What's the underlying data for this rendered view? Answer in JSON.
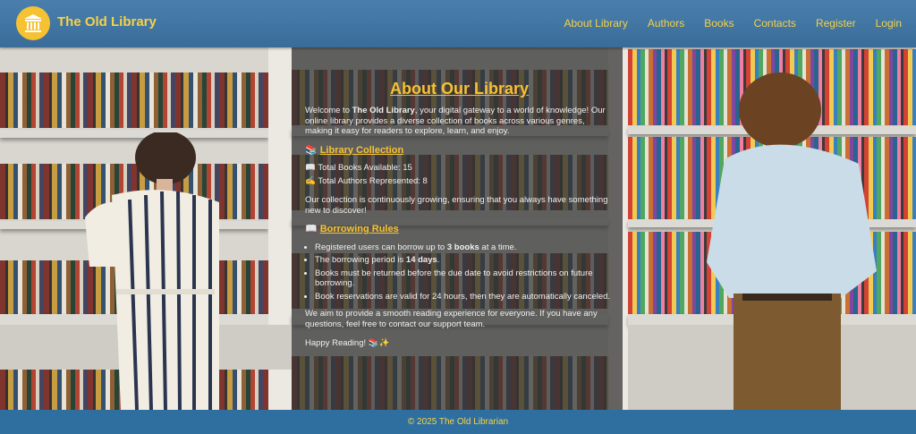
{
  "header": {
    "brand": "The Old Library",
    "nav": [
      "About Library",
      "Authors",
      "Books",
      "Contacts",
      "Register",
      "Login"
    ]
  },
  "about": {
    "title": "About Our Library",
    "intro_pre": "Welcome to ",
    "intro_bold": "The Old Library",
    "intro_post": ", your digital gateway to a world of knowledge! Our online library provides a diverse collection of books across various genres, making it easy for readers to explore, learn, and enjoy.",
    "collection_heading_icon": "📚",
    "collection_heading": "Library Collection",
    "stat_books_icon": "📖",
    "stat_books": "Total Books Available: 15",
    "stat_authors_icon": "✍",
    "stat_authors": "Total Authors Represented: 8",
    "collection_text": "Our collection is continuously growing, ensuring that you always have something new to discover!",
    "rules_heading_icon": "📖",
    "rules_heading": "Borrowing Rules",
    "rule1_pre": "Registered users can borrow up to ",
    "rule1_bold": "3 books",
    "rule1_post": " at a time.",
    "rule2_pre": "The borrowing period is ",
    "rule2_bold": "14 days",
    "rule2_post": ".",
    "rule3": "Books must be returned before the due date to avoid restrictions on future borrowing.",
    "rule4": "Book reservations are valid for 24 hours, then they are automatically canceled.",
    "closing": "We aim to provide a smooth reading experience for everyone. If you have any questions, feel free to contact our support team.",
    "signoff": "Happy Reading! 📚✨"
  },
  "footer": {
    "text": "© 2025 The Old Librarian"
  },
  "colors": {
    "header": "#3f74a3",
    "accent": "#f6c232",
    "footer": "#2f6fa0"
  }
}
